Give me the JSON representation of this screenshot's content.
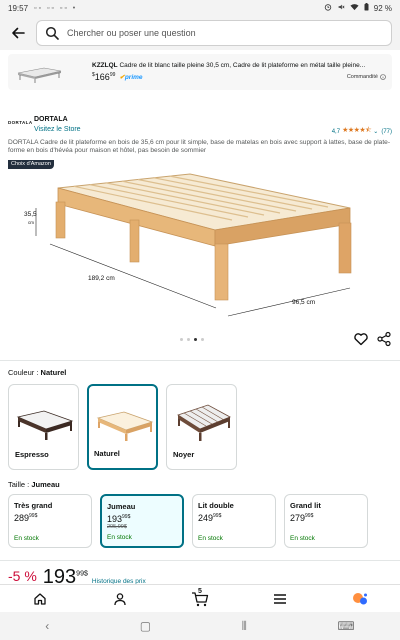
{
  "status_bar": {
    "time": "19:57",
    "indicators": "▫▫ ▫▫ ▫▫ •",
    "battery": "92 %"
  },
  "search": {
    "placeholder": "Chercher ou poser une question"
  },
  "sponsored": {
    "brand": "KZZLQL",
    "title_rest": " Cadre de lit blanc taille pleine 30,5 cm, Cadre de lit plateforme en métal taille pleine...",
    "price_whole": "166",
    "price_frac": "99",
    "currency": "$",
    "prime": "prime",
    "ad_label": "Commandité"
  },
  "product": {
    "brand_logo": "DORTALA",
    "brand_name": "DORTALA",
    "visit_store": "Visitez le Store",
    "rating_value": "4,7",
    "rating_count": "(77)",
    "title": "DORTALA Cadre de lit plateforme en bois de 35,6 cm pour lit simple, base de matelas en bois avec support à lattes, base de plate-forme en bois d'hévéa pour maison et hôtel, pas besoin de sommier",
    "badge": "Choix d'Amazon",
    "dim_height": "35,5",
    "dim_height_unit": "cm",
    "dim_length": "189,2 cm",
    "dim_width": "96,5 cm"
  },
  "color": {
    "label": "Couleur :",
    "selected": "Naturel",
    "options": [
      "Espresso",
      "Naturel",
      "Noyer"
    ]
  },
  "size": {
    "label": "Taille :",
    "selected": "Jumeau",
    "options": [
      {
        "name": "Très grand",
        "price_whole": "289",
        "price_frac": "99",
        "currency": "$",
        "old_price": "",
        "stock": "En stock"
      },
      {
        "name": "Jumeau",
        "price_whole": "193",
        "price_frac": "99",
        "currency": "$",
        "old_price": "205,99$",
        "stock": "En stock"
      },
      {
        "name": "Lit double",
        "price_whole": "249",
        "price_frac": "99",
        "currency": "$",
        "old_price": "",
        "stock": "En stock"
      },
      {
        "name": "Grand lit",
        "price_whole": "279",
        "price_frac": "99",
        "currency": "$",
        "old_price": "",
        "stock": "En stock"
      }
    ]
  },
  "price": {
    "discount": "-5 %",
    "whole": "193",
    "frac": "99",
    "currency": "$",
    "history": "Historique des prix"
  },
  "cart": {
    "count": "5"
  },
  "colors": {
    "link": "#007185",
    "price_red": "#cc0c39",
    "star": "#de7921",
    "in_stock": "#007600",
    "badge_bg": "#232f3e"
  }
}
